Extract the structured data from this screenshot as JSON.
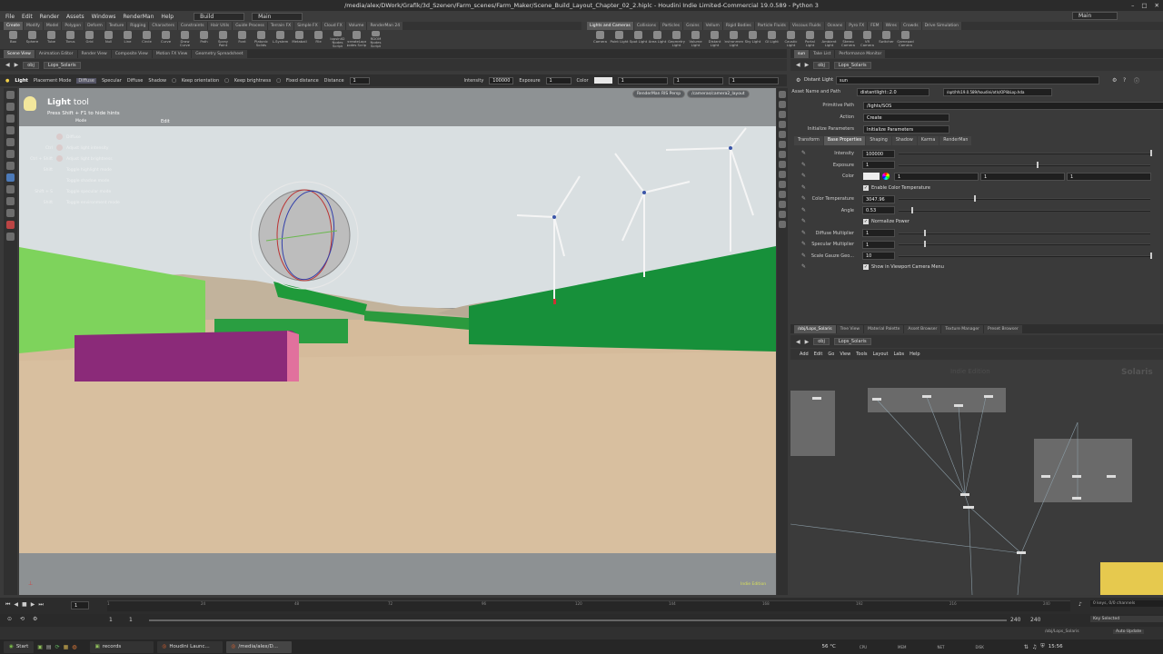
{
  "window": {
    "title": "/media/alex/DWork/Grafik/3d_Szenen/Farm_scenes/Farm_Maker/Scene_Build_Layout_Chapter_02_2.hiplc - Houdini Indie Limited-Commercial 19.0.589 - Python 3"
  },
  "menubar": {
    "items": [
      "File",
      "Edit",
      "Render",
      "Assets",
      "Windows",
      "RenderMan",
      "Help"
    ],
    "build": "Build",
    "desktop": "Main",
    "right_desktop": "Main"
  },
  "shelf_tabs_left": [
    "Create",
    "Modify",
    "Model",
    "Polygon",
    "Deform",
    "Texture",
    "Rigging",
    "Characters",
    "Constraints",
    "Hair Utils",
    "Guide Process",
    "Terrain FX",
    "Simple FX",
    "Cloud FX",
    "Volume",
    "RenderMan 24"
  ],
  "shelf_tabs_right": [
    "Lights and Cameras",
    "Collisions",
    "Particles",
    "Grains",
    "Vellum",
    "Rigid Bodies",
    "Particle Fluids",
    "Viscous Fluids",
    "Oceans",
    "Pyro FX",
    "FEM",
    "Wires",
    "Crowds",
    "Drive Simulation"
  ],
  "shelf_tools_left": [
    "Box",
    "Sphere",
    "Tube",
    "Torus",
    "Grid",
    "Null",
    "Line",
    "Circle",
    "Curve",
    "Draw Curve",
    "Path",
    "Spray Paint",
    "Font",
    "Platonic Solids",
    "L-System",
    "Metaball",
    "File",
    "lopsinit2 Nodes Script",
    "recreateLops2 Nodes Script",
    "RDOM Nodes Script"
  ],
  "shelf_tools_right": [
    "Camera",
    "Point Light",
    "Spot Light",
    "Area Light",
    "Geometry Light",
    "Volume Light",
    "Distant Light",
    "Environment Light",
    "Sky Light",
    "GI Light",
    "Caustic Light",
    "Portal Light",
    "Ambient Light",
    "Stereo Camera",
    "VR Camera",
    "Switcher",
    "Gamepad Camera"
  ],
  "pane_tabs_left": [
    "Scene View",
    "Animation Editor",
    "Render View",
    "Composite View",
    "Motion FX View",
    "Geometry Spreadsheet"
  ],
  "pane_tabs_right": [
    "sun",
    "Take List",
    "Performance Monitor"
  ],
  "viewport_path": {
    "obj": "obj",
    "net": "Lops_Solaris"
  },
  "param_path": {
    "obj": "obj",
    "net": "Lops_Solaris"
  },
  "light_options": {
    "tool": "Light",
    "mode": "Placement Mode",
    "modes": [
      "Diffuse",
      "Specular",
      "Diffuse",
      "Shadow"
    ],
    "keep_orientation": "Keep orientation",
    "keep_brightness": "Keep brightness",
    "fixed_distance": "Fixed distance",
    "distance_label": "Distance",
    "distance": "1",
    "intensity_label": "Intensity",
    "intensity": "100000",
    "exposure_label": "Exposure",
    "exposure": "1",
    "color_label": "Color",
    "c1": "1",
    "c2": "1",
    "c3": "1"
  },
  "light_tool_hint": {
    "title_bold": "Light",
    "title_rest": " tool",
    "line": "Press Shift + F1 to hide hints",
    "mode_col": "Mode",
    "edit_col": "Edit"
  },
  "hints": [
    {
      "key": "",
      "text": "Diffuse"
    },
    {
      "key": "Ctrl",
      "text": "Adjust light intensity"
    },
    {
      "key": "Ctrl + Shift",
      "text": "Adjust light brightness"
    },
    {
      "key": "Shift",
      "text": "Toggle highlight mode"
    },
    {
      "key": "",
      "text": "Toggle shadow mode"
    },
    {
      "key": "Shift + S",
      "text": "Toggle specular mode"
    },
    {
      "key": "Shift",
      "text": "Toggle environment mode"
    }
  ],
  "viewport_badges": {
    "renderer": "RenderMan RIS Persp",
    "camera": "/cameras/camera2_layout"
  },
  "viewport_footer": {
    "edition": "Indie Edition"
  },
  "param_header": {
    "type": "Distant Light",
    "name": "sun",
    "asset_label": "Asset Name and Path",
    "asset": "distantlight::2.0",
    "asset_path": "/opt/hfs19.0.589/houdini/otls/OPlibLop.hda"
  },
  "param_top": [
    {
      "label": "Primitive Path",
      "value": "/lights/SOS"
    },
    {
      "label": "Action",
      "value": "Create"
    },
    {
      "label": "Initialize Parameters",
      "value": "Initialize Parameters"
    }
  ],
  "param_tabs": [
    "Transform",
    "Base Properties",
    "Shaping",
    "Shadow",
    "Karma",
    "RenderMan"
  ],
  "params": [
    {
      "label": "Intensity",
      "value": "100000",
      "slider": 1.0
    },
    {
      "label": "Exposure",
      "value": "1",
      "slider": 0.55
    },
    {
      "label": "Color",
      "value": "1",
      "v2": "1",
      "v3": "1"
    },
    {
      "label": "",
      "value": "Enable Color Temperature",
      "check": true
    },
    {
      "label": "Color Temperature",
      "value": "3047.96",
      "slider": 0.3
    },
    {
      "label": "Angle",
      "value": "0.53",
      "slider": 0.05
    },
    {
      "label": "",
      "value": "Normalize Power",
      "check": true
    },
    {
      "label": "Diffuse Multiplier",
      "value": "1",
      "slider": 0.1
    },
    {
      "label": "Specular Multiplier",
      "value": "1",
      "slider": 0.1
    },
    {
      "label": "Scale Gauze Geo...",
      "value": "10",
      "slider": 1.0
    },
    {
      "label": "",
      "value": "Show in Viewport Camera Menu",
      "check": true
    }
  ],
  "node_tabs": [
    "/obj/Lops_Solaris",
    "Tree View",
    "Material Palette",
    "Asset Browser",
    "Texture Manager",
    "Preset Browser"
  ],
  "net_path": {
    "obj": "obj",
    "net": "Lops_Solaris"
  },
  "net_menu": [
    "Add",
    "Edit",
    "Go",
    "View",
    "Tools",
    "Layout",
    "Labs",
    "Help"
  ],
  "net_watermark": {
    "indie": "Indie Edition",
    "ctx": "Solaris"
  },
  "timeline": {
    "frame": "1",
    "ticks": [
      "1",
      "24",
      "48",
      "72",
      "96",
      "120",
      "144",
      "168",
      "192",
      "216",
      "240"
    ],
    "start": "1",
    "start2": "1",
    "end": "240",
    "end2": "240",
    "keys": "0 keys, 0/0 channels",
    "key_selected": "Key Selected",
    "auto_update": "Auto Update",
    "status_path": "/obj/Lops_Solaris"
  },
  "taskbar": {
    "start": "Start",
    "tasks": [
      "records",
      "Houdini Launc...",
      "/media/alex/D..."
    ],
    "temp": "56 °C",
    "meters": [
      "CPU",
      "MEM",
      "NET",
      "DISK"
    ],
    "clock": "15:56"
  }
}
